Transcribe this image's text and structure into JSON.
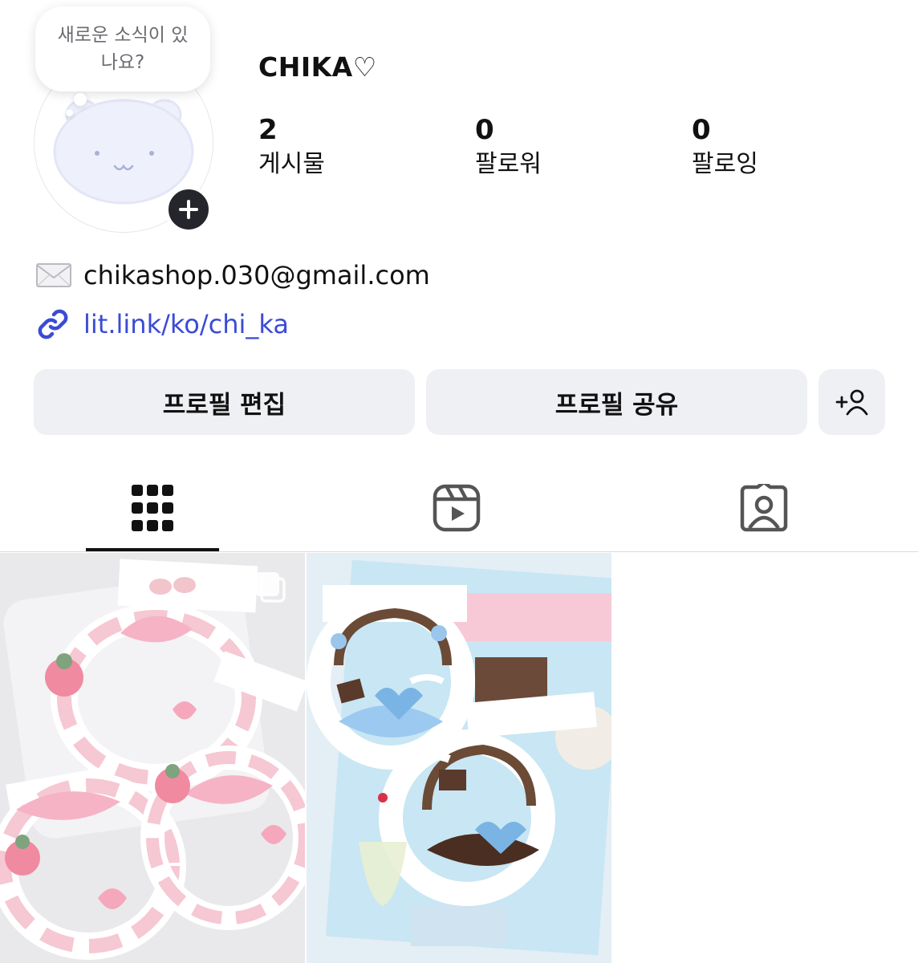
{
  "story_bubble": {
    "text": "새로운 소식이 있나요?"
  },
  "profile": {
    "username": "CHIKA♡",
    "stats": [
      {
        "value": "2",
        "label": "게시물"
      },
      {
        "value": "0",
        "label": "팔로워"
      },
      {
        "value": "0",
        "label": "팔로잉"
      }
    ],
    "email": "chikashop.030@gmail.com",
    "link": "lit.link/ko/chi_ka"
  },
  "buttons": {
    "edit_profile": "프로필 편집",
    "share_profile": "프로필 공유"
  },
  "icons": {
    "add_story": "plus-icon",
    "email": "envelope-icon",
    "link": "link-icon",
    "discover_people": "person-add-icon",
    "tab_grid": "grid-icon",
    "tab_reels": "reels-icon",
    "tab_tagged": "tagged-person-icon",
    "multi_post": "multiple-images-icon"
  },
  "colors": {
    "link": "#3b4bd6",
    "button_bg": "#eff0f4",
    "add_badge": "#25262b"
  },
  "posts": [
    {
      "alt": "post-1"
    },
    {
      "alt": "post-2"
    }
  ]
}
